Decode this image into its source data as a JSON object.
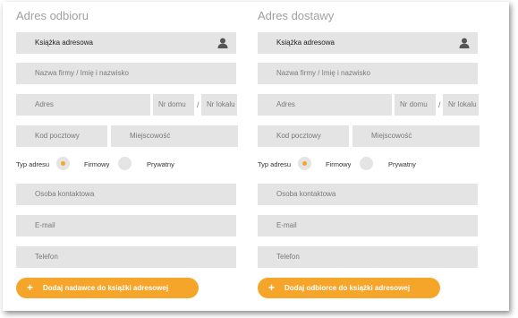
{
  "sender": {
    "heading": "Adres odbioru",
    "address_book": "Książka adresowa",
    "company_name": "Nazwa firmy / Imię i nazwisko",
    "street": "Adres",
    "house_no": "Nr domu",
    "separator": "/",
    "apartment_no": "Nr lokalu",
    "postal_code": "Kod pocztowy",
    "city": "Miejscowość",
    "address_type_label": "Typ adresu",
    "type_company": "Firmowy",
    "type_private": "Prywatny",
    "selected_type": "Firmowy",
    "contact_person": "Osoba kontaktowa",
    "email": "E-mail",
    "phone": "Telefon",
    "add_button": "Dodaj nadawce do książki adresowej"
  },
  "recipient": {
    "heading": "Adres dostawy",
    "address_book": "Książka adresowa",
    "company_name": "Nazwa firmy / Imię i nazwisko",
    "street": "Adres",
    "house_no": "Nr domu",
    "separator": "/",
    "apartment_no": "Nr lokalu",
    "postal_code": "Kod pocztowy",
    "city": "Miejscowość",
    "address_type_label": "Typ adresu",
    "type_company": "Firmowy",
    "type_private": "Prywatny",
    "selected_type": "Firmowy",
    "contact_person": "Osoba kontaktowa",
    "email": "E-mail",
    "phone": "Telefon",
    "add_button": "Dodaj odbiorce do książki adresowej"
  },
  "plus_symbol": "+",
  "colors": {
    "accent": "#f5a52a",
    "field_bg": "#e4e4e4",
    "heading": "#a0a0a0"
  }
}
